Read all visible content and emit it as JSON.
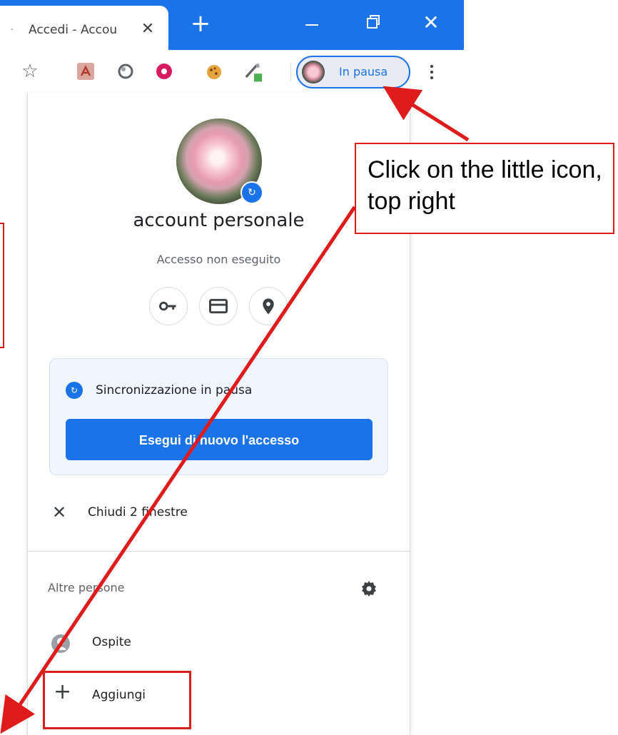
{
  "tab": {
    "title": "Accedi - Accou",
    "close_glyph": "✕"
  },
  "window_controls": {
    "new_tab_glyph": "+",
    "close_glyph": "✕"
  },
  "toolbar": {
    "star_glyph": "☆",
    "profile_chip_label": "In pausa"
  },
  "popup": {
    "profile_name": "account personale",
    "profile_status": "Accesso non eseguito",
    "sync_card": {
      "text": "Sincronizzazione in pausa",
      "button_label": "Esegui di nuovo l'accesso"
    },
    "close_windows_label": "Chiudi 2 finestre",
    "others_header": "Altre persone",
    "guest_label": "Ospite",
    "add_label": "Aggiungi"
  },
  "annotation": {
    "callout_text": "Click on the little icon, top right",
    "highlight_color": "#e01b1b"
  },
  "colors": {
    "accent": "#1a73e8",
    "annotation_red": "#e01b1b"
  },
  "icons": [
    "star-icon",
    "pdf-extension-icon",
    "circle-extension-icon",
    "donut-extension-icon",
    "cookie-extension-icon",
    "eyedropper-extension-icon",
    "sync-paused-icon",
    "key-icon",
    "credit-card-icon",
    "location-pin-icon",
    "close-icon",
    "gear-icon",
    "guest-avatar-icon",
    "plus-icon"
  ]
}
